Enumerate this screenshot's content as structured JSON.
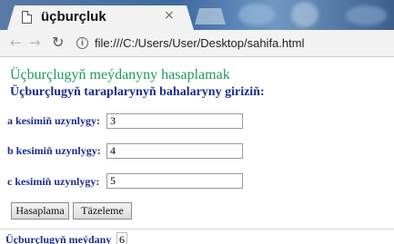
{
  "browser": {
    "tab_title": "üçburçluk",
    "tab_close": "×",
    "address": "file:///C:/Users/User/Desktop/sahifa.html"
  },
  "page": {
    "heading": "Üçburçlugyň meýdanyny hasaplamak",
    "subheading": "Üçburçlugyň taraplarynyň bahalaryny giriziň:",
    "fields": [
      {
        "label": "a kesimiň uzynlygy:",
        "value": "3"
      },
      {
        "label": "b kesimiň uzynlygy:",
        "value": "4"
      },
      {
        "label": "c kesimiň uzynlygy:",
        "value": "5"
      }
    ],
    "buttons": {
      "calculate": "Hasaplama",
      "reset": "Täzeleme"
    },
    "result": {
      "label": "Üçburçlugyň meýdany",
      "value": "6"
    }
  },
  "icons": {
    "tab": "page-icon",
    "back": "back-arrow-icon",
    "forward": "forward-arrow-icon",
    "reload": "reload-icon",
    "info": "info-icon"
  },
  "colors": {
    "heading": "#1f9a5a",
    "label": "#1b2d8a"
  }
}
